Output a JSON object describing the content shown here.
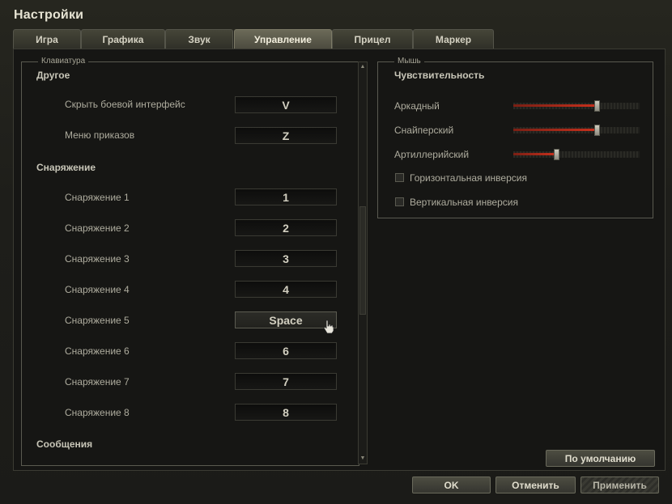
{
  "window": {
    "title": "Настройки"
  },
  "tabs": [
    {
      "label": "Игра"
    },
    {
      "label": "Графика"
    },
    {
      "label": "Звук"
    },
    {
      "label": "Управление",
      "active": true
    },
    {
      "label": "Прицел"
    },
    {
      "label": "Маркер"
    }
  ],
  "keyboard": {
    "legend": "Клавиатура",
    "sections": [
      {
        "title": "Другое",
        "rows": [
          {
            "label": "Скрыть боевой интерфейс",
            "key": "V"
          },
          {
            "label": "Меню приказов",
            "key": "Z"
          }
        ]
      },
      {
        "title": "Снаряжение",
        "rows": [
          {
            "label": "Снаряжение 1",
            "key": "1"
          },
          {
            "label": "Снаряжение 2",
            "key": "2"
          },
          {
            "label": "Снаряжение 3",
            "key": "3"
          },
          {
            "label": "Снаряжение 4",
            "key": "4"
          },
          {
            "label": "Снаряжение 5",
            "key": "Space"
          },
          {
            "label": "Снаряжение 6",
            "key": "6"
          },
          {
            "label": "Снаряжение 7",
            "key": "7"
          },
          {
            "label": "Снаряжение 8",
            "key": "8"
          }
        ]
      },
      {
        "title": "Сообщения",
        "rows": []
      }
    ]
  },
  "mouse": {
    "legend": "Мышь",
    "title": "Чувствительность",
    "sliders": [
      {
        "label": "Аркадный",
        "value": 0.66
      },
      {
        "label": "Снайперский",
        "value": 0.66
      },
      {
        "label": "Артиллерийский",
        "value": 0.34
      }
    ],
    "checkboxes": [
      {
        "label": "Горизонтальная инверсия",
        "checked": false
      },
      {
        "label": "Вертикальная инверсия",
        "checked": false
      }
    ],
    "default_button": "По умолчанию"
  },
  "footer": {
    "ok": "OK",
    "cancel": "Отменить",
    "apply": "Применить"
  },
  "colors": {
    "accent_red": "#c8301c",
    "text": "#c8c6b8"
  },
  "icons": {
    "pointer": "hand-pointer-icon",
    "scroll_up": "arrow-up-icon",
    "scroll_down": "arrow-down-icon"
  }
}
